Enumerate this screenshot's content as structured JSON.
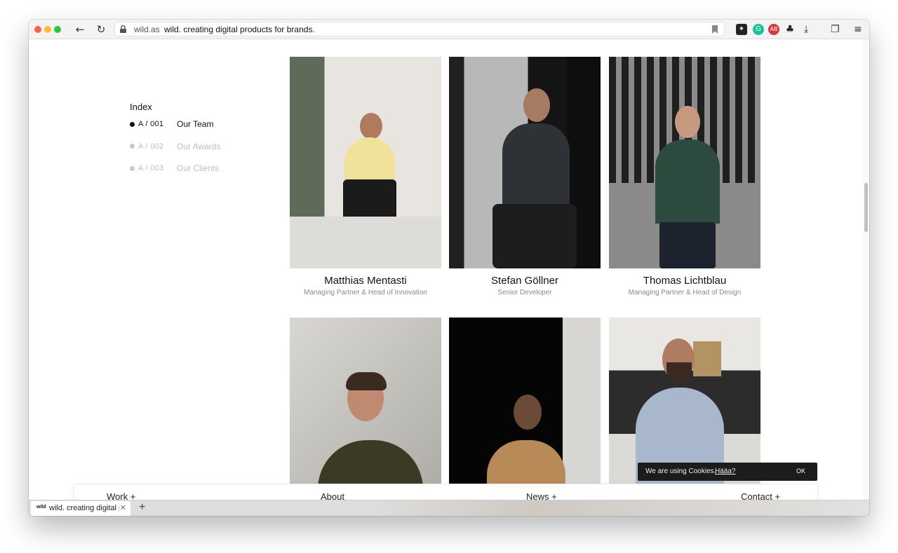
{
  "browser": {
    "domain": "wild.as",
    "page_title": "wild. creating digital products for brands.",
    "tab_label": "wild. creating digital pr...",
    "tab_favicon": "wild",
    "extensions": [
      "dark-extension-icon",
      "grammarly-icon",
      "adblock-icon",
      "tree-icon"
    ],
    "new_tab_label": "+"
  },
  "index": {
    "title": "Index",
    "items": [
      {
        "code": "A / 001",
        "label": "Our Team",
        "active": true
      },
      {
        "code": "A / 002",
        "label": "Our Awards",
        "active": false
      },
      {
        "code": "A / 003",
        "label": "Our Clients",
        "active": false
      }
    ]
  },
  "team": [
    {
      "name": "Matthias Mentasti",
      "role": "Managing Partner & Head of Innovation"
    },
    {
      "name": "Stefan Göllner",
      "role": "Senior Developer"
    },
    {
      "name": "Thomas Lichtblau",
      "role": "Managing Partner & Head of Design"
    },
    {
      "name": "",
      "role": ""
    },
    {
      "name": "",
      "role": ""
    },
    {
      "name": "",
      "role": ""
    }
  ],
  "cookie": {
    "text": "We are using Cookies.",
    "link": "Hääa?",
    "ok": "OK"
  },
  "nav": {
    "work": "Work +",
    "about": "About",
    "news": "News +",
    "contact": "Contact +"
  }
}
